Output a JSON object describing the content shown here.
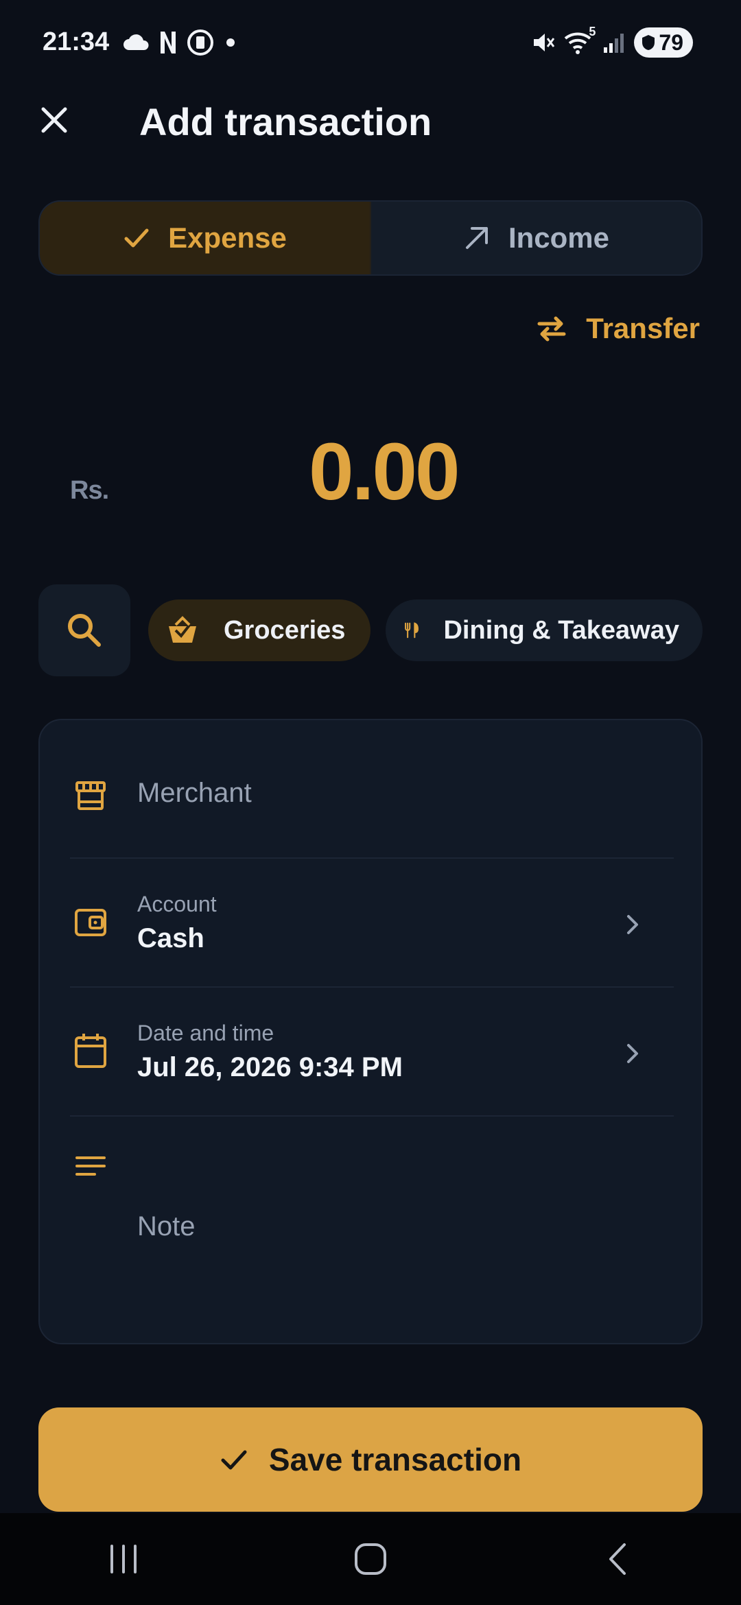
{
  "status_bar": {
    "time": "21:34",
    "battery": "79",
    "network_badge": "5",
    "icons": [
      "cloud-icon",
      "n-icon",
      "shield-app-icon",
      "dot-icon",
      "mute-icon",
      "wifi-icon",
      "signal-icon",
      "battery-icon"
    ]
  },
  "header": {
    "title": "Add transaction"
  },
  "type_toggle": {
    "expense_label": "Expense",
    "income_label": "Income",
    "selected": "Expense"
  },
  "transfer": {
    "label": "Transfer"
  },
  "amount": {
    "currency": "Rs.",
    "value": "0.00"
  },
  "categories": [
    {
      "label": "Groceries",
      "icon": "basket-icon",
      "selected": true
    },
    {
      "label": "Dining & Takeaway",
      "icon": "utensils-icon",
      "selected": false
    }
  ],
  "form": {
    "merchant_placeholder": "Merchant",
    "account_label": "Account",
    "account_value": "Cash",
    "datetime_label": "Date and time",
    "datetime_value": "Jul 26, 2026 9:34 PM",
    "note_placeholder": "Note"
  },
  "save": {
    "label": "Save transaction"
  },
  "colors": {
    "accent": "#dca445",
    "background": "#0b0f18",
    "card": "#111926"
  }
}
